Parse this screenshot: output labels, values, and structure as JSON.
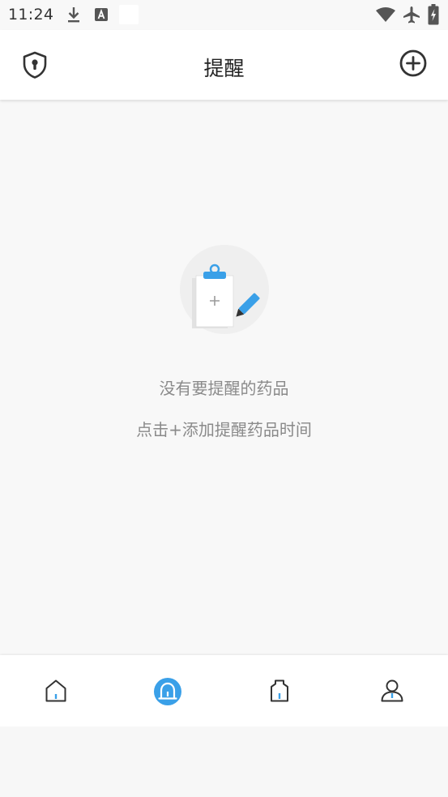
{
  "status_bar": {
    "time": "11:24",
    "icons": [
      "download-icon",
      "font-icon",
      "blank-notification",
      "wifi-icon",
      "airplane-icon",
      "battery-charging-icon"
    ]
  },
  "app_bar": {
    "title": "提醒",
    "left_icon": "shield-icon",
    "right_icon": "add-circle-icon"
  },
  "empty_state": {
    "icon": "clipboard-pencil-icon",
    "title": "没有要提醒的药品",
    "hint": "点击+添加提醒药品时间"
  },
  "bottom_nav": {
    "items": [
      {
        "icon": "home-icon",
        "active": false
      },
      {
        "icon": "bell-icon",
        "active": true
      },
      {
        "icon": "medicine-bottle-icon",
        "active": false
      },
      {
        "icon": "person-icon",
        "active": false
      }
    ]
  },
  "colors": {
    "accent": "#3aa0e8",
    "background": "#f8f8f8",
    "text_primary": "#222222",
    "text_secondary": "#8a8a8a",
    "icon_dark": "#333333"
  }
}
